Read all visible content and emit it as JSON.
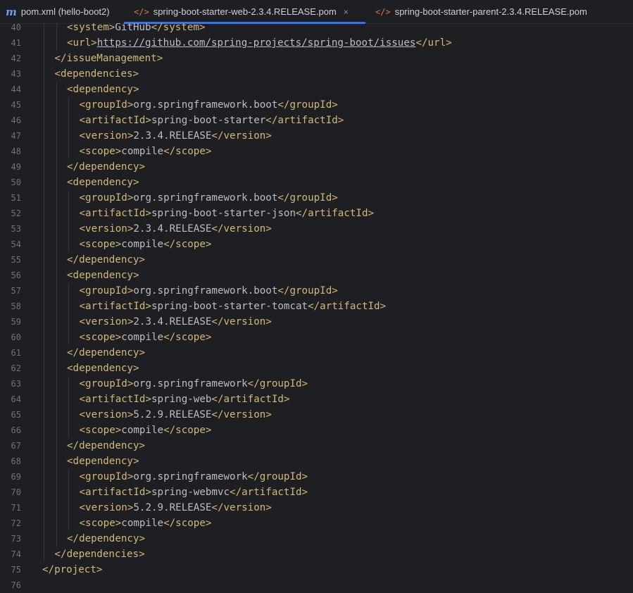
{
  "tabs": [
    {
      "label": "pom.xml (hello-boot2)",
      "icon": "maven-icon",
      "active": false
    },
    {
      "label": "spring-boot-starter-web-2.3.4.RELEASE.pom",
      "icon": "xml-file-icon",
      "active": true,
      "close": "×"
    },
    {
      "label": "spring-boot-starter-parent-2.3.4.RELEASE.pom",
      "icon": "xml-file-icon",
      "active": false
    }
  ],
  "editor": {
    "lines": [
      {
        "n": "40",
        "indent": 2,
        "segs": [
          [
            "t",
            "<system>"
          ],
          [
            "v",
            "GitHub"
          ],
          [
            "t",
            "</system>"
          ]
        ]
      },
      {
        "n": "41",
        "indent": 2,
        "segs": [
          [
            "t",
            "<url>"
          ],
          [
            "u",
            "https://github.com/spring-projects/spring-boot/issues"
          ],
          [
            "t",
            "</url>"
          ]
        ]
      },
      {
        "n": "42",
        "indent": 1,
        "segs": [
          [
            "t",
            "</issueManagement>"
          ]
        ]
      },
      {
        "n": "43",
        "indent": 1,
        "segs": [
          [
            "t",
            "<dependencies>"
          ]
        ]
      },
      {
        "n": "44",
        "indent": 2,
        "segs": [
          [
            "t",
            "<dependency>"
          ]
        ]
      },
      {
        "n": "45",
        "indent": 3,
        "segs": [
          [
            "t",
            "<groupId>"
          ],
          [
            "v",
            "org.springframework.boot"
          ],
          [
            "t",
            "</groupId>"
          ]
        ]
      },
      {
        "n": "46",
        "indent": 3,
        "segs": [
          [
            "t",
            "<artifactId>"
          ],
          [
            "v",
            "spring-boot-starter"
          ],
          [
            "t",
            "</artifactId>"
          ]
        ]
      },
      {
        "n": "47",
        "indent": 3,
        "segs": [
          [
            "t",
            "<version>"
          ],
          [
            "v",
            "2.3.4.RELEASE"
          ],
          [
            "t",
            "</version>"
          ]
        ]
      },
      {
        "n": "48",
        "indent": 3,
        "segs": [
          [
            "t",
            "<scope>"
          ],
          [
            "v",
            "compile"
          ],
          [
            "t",
            "</scope>"
          ]
        ]
      },
      {
        "n": "49",
        "indent": 2,
        "segs": [
          [
            "t",
            "</dependency>"
          ]
        ]
      },
      {
        "n": "50",
        "indent": 2,
        "segs": [
          [
            "t",
            "<dependency>"
          ]
        ]
      },
      {
        "n": "51",
        "indent": 3,
        "segs": [
          [
            "t",
            "<groupId>"
          ],
          [
            "v",
            "org.springframework.boot"
          ],
          [
            "t",
            "</groupId>"
          ]
        ]
      },
      {
        "n": "52",
        "indent": 3,
        "segs": [
          [
            "t",
            "<artifactId>"
          ],
          [
            "v",
            "spring-boot-starter-json"
          ],
          [
            "t",
            "</artifactId>"
          ]
        ]
      },
      {
        "n": "53",
        "indent": 3,
        "segs": [
          [
            "t",
            "<version>"
          ],
          [
            "v",
            "2.3.4.RELEASE"
          ],
          [
            "t",
            "</version>"
          ]
        ]
      },
      {
        "n": "54",
        "indent": 3,
        "segs": [
          [
            "t",
            "<scope>"
          ],
          [
            "v",
            "compile"
          ],
          [
            "t",
            "</scope>"
          ]
        ]
      },
      {
        "n": "55",
        "indent": 2,
        "segs": [
          [
            "t",
            "</dependency>"
          ]
        ]
      },
      {
        "n": "56",
        "indent": 2,
        "segs": [
          [
            "t",
            "<dependency>"
          ]
        ]
      },
      {
        "n": "57",
        "indent": 3,
        "segs": [
          [
            "t",
            "<groupId>"
          ],
          [
            "v",
            "org.springframework.boot"
          ],
          [
            "t",
            "</groupId>"
          ]
        ]
      },
      {
        "n": "58",
        "indent": 3,
        "segs": [
          [
            "t",
            "<artifactId>"
          ],
          [
            "v",
            "spring-boot-starter-tomcat"
          ],
          [
            "t",
            "</artifactId>"
          ]
        ]
      },
      {
        "n": "59",
        "indent": 3,
        "segs": [
          [
            "t",
            "<version>"
          ],
          [
            "v",
            "2.3.4.RELEASE"
          ],
          [
            "t",
            "</version>"
          ]
        ]
      },
      {
        "n": "60",
        "indent": 3,
        "segs": [
          [
            "t",
            "<scope>"
          ],
          [
            "v",
            "compile"
          ],
          [
            "t",
            "</scope>"
          ]
        ]
      },
      {
        "n": "61",
        "indent": 2,
        "segs": [
          [
            "t",
            "</dependency>"
          ]
        ]
      },
      {
        "n": "62",
        "indent": 2,
        "segs": [
          [
            "t",
            "<dependency>"
          ]
        ]
      },
      {
        "n": "63",
        "indent": 3,
        "segs": [
          [
            "t",
            "<groupId>"
          ],
          [
            "v",
            "org.springframework"
          ],
          [
            "t",
            "</groupId>"
          ]
        ]
      },
      {
        "n": "64",
        "indent": 3,
        "segs": [
          [
            "t",
            "<artifactId>"
          ],
          [
            "v",
            "spring-web"
          ],
          [
            "t",
            "</artifactId>"
          ]
        ]
      },
      {
        "n": "65",
        "indent": 3,
        "segs": [
          [
            "t",
            "<version>"
          ],
          [
            "v",
            "5.2.9.RELEASE"
          ],
          [
            "t",
            "</version>"
          ]
        ]
      },
      {
        "n": "66",
        "indent": 3,
        "segs": [
          [
            "t",
            "<scope>"
          ],
          [
            "v",
            "compile"
          ],
          [
            "t",
            "</scope>"
          ]
        ]
      },
      {
        "n": "67",
        "indent": 2,
        "segs": [
          [
            "t",
            "</dependency>"
          ]
        ]
      },
      {
        "n": "68",
        "indent": 2,
        "segs": [
          [
            "t",
            "<dependency>"
          ]
        ]
      },
      {
        "n": "69",
        "indent": 3,
        "segs": [
          [
            "t",
            "<groupId>"
          ],
          [
            "v",
            "org.springframework"
          ],
          [
            "t",
            "</groupId>"
          ]
        ]
      },
      {
        "n": "70",
        "indent": 3,
        "segs": [
          [
            "t",
            "<artifactId>"
          ],
          [
            "v",
            "spring-webmvc"
          ],
          [
            "t",
            "</artifactId>"
          ]
        ]
      },
      {
        "n": "71",
        "indent": 3,
        "segs": [
          [
            "t",
            "<version>"
          ],
          [
            "v",
            "5.2.9.RELEASE"
          ],
          [
            "t",
            "</version>"
          ]
        ]
      },
      {
        "n": "72",
        "indent": 3,
        "segs": [
          [
            "t",
            "<scope>"
          ],
          [
            "v",
            "compile"
          ],
          [
            "t",
            "</scope>"
          ]
        ]
      },
      {
        "n": "73",
        "indent": 2,
        "segs": [
          [
            "t",
            "</dependency>"
          ]
        ]
      },
      {
        "n": "74",
        "indent": 1,
        "segs": [
          [
            "t",
            "</dependencies>"
          ]
        ]
      },
      {
        "n": "75",
        "indent": 0,
        "segs": [
          [
            "t",
            "</project>"
          ]
        ]
      },
      {
        "n": "76",
        "indent": 0,
        "segs": []
      }
    ]
  },
  "colors": {
    "background": "#1e1f22",
    "tag": "#d5b778",
    "text": "#bcbec4",
    "line_number": "#6f737a",
    "active_tab_underline": "#3574f0"
  }
}
